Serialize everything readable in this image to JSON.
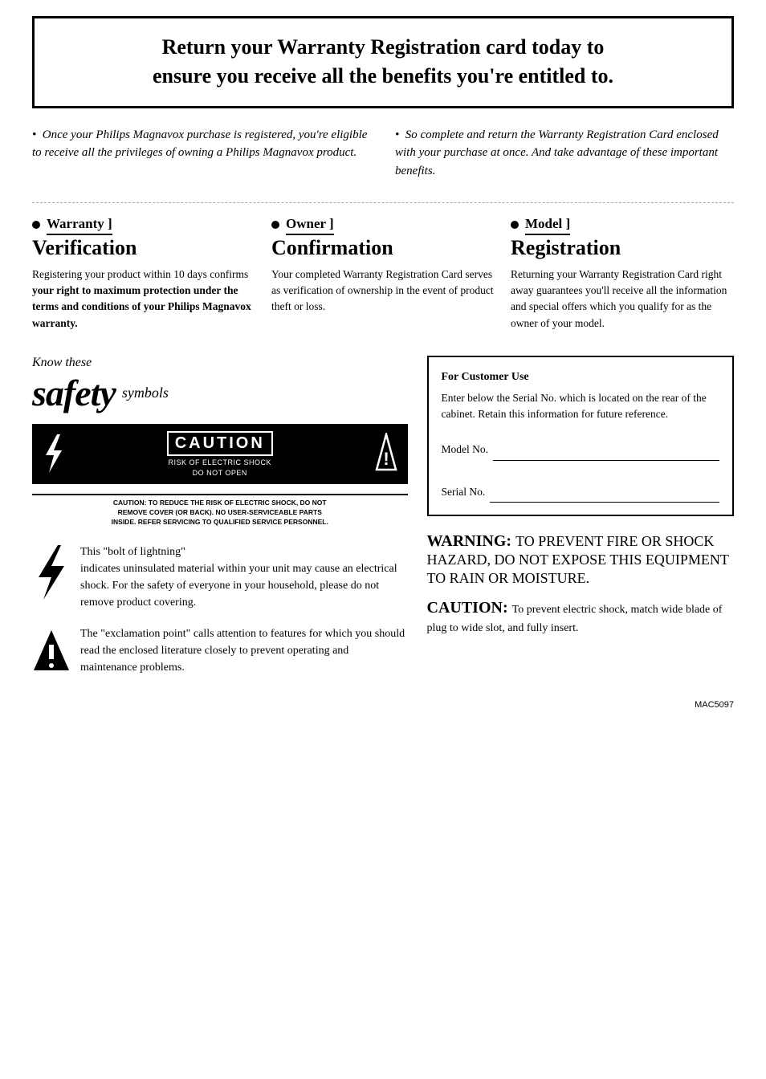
{
  "header": {
    "line1": "Return your Warranty Registration card today to",
    "line2": "ensure you receive all the benefits you're entitled to."
  },
  "intro": {
    "col1": "Once your Philips Magnavox purchase is registered, you're eligible to receive all the privileges of owning a Philips Magnavox product.",
    "col2": "So complete and return the Warranty Registration Card enclosed with your purchase at once. And take advantage of these important benefits."
  },
  "columns": {
    "warranty": {
      "tab": "Warranty ]",
      "title": "Verification",
      "body": "Registering your product within 10 days confirms your right to maximum protection under the terms and conditions of your Philips Magnavox warranty."
    },
    "owner": {
      "tab": "Owner ]",
      "title": "Confirmation",
      "body": "Your completed Warranty Registration Card serves as verification of ownership in the event of product theft or loss."
    },
    "model": {
      "tab": "Model ]",
      "title": "Registration",
      "body": "Returning your Warranty Registration Card right away guarantees you'll receive all the information and special offers which you qualify for as the owner of your model."
    }
  },
  "safety": {
    "know_these": "Know these",
    "big_text": "safety",
    "symbols_label": "symbols"
  },
  "caution_box": {
    "word": "CAUTION",
    "sub1": "RISK OF ELECTRIC SHOCK",
    "sub2": "DO NOT OPEN",
    "footer": "CAUTION: TO REDUCE THE RISK OF ELECTRIC SHOCK, DO NOT\nREMOVE COVER (OR BACK). NO USER-SERVICEABLE PARTS\nINSIDE. REFER SERVICING TO QUALIFIED SERVICE PERSONNEL."
  },
  "bolt_section": {
    "intro": "This \"bolt of lightning\"",
    "text": "indicates uninsulated material within your unit may cause an electrical shock. For the safety of everyone in your household, please do not remove product covering."
  },
  "excl_section": {
    "intro": "The \"exclamation point\" calls attention to features for which you should read the enclosed literature closely to prevent operating and maintenance problems."
  },
  "customer_use": {
    "title": "For Customer Use",
    "body": "Enter below the Serial No. which is located on the rear of the cabinet. Retain this information for future reference.",
    "model_label": "Model No.",
    "serial_label": "Serial No."
  },
  "warning": {
    "label": "WARNING:",
    "text": "TO PREVENT FIRE OR SHOCK HAZARD, DO NOT EXPOSE THIS EQUIPMENT TO RAIN OR MOISTURE."
  },
  "caution_bottom": {
    "label": "CAUTION:",
    "text": "To prevent electric shock, match wide blade of plug to wide slot, and fully insert."
  },
  "footer": {
    "code": "MAC5097"
  }
}
